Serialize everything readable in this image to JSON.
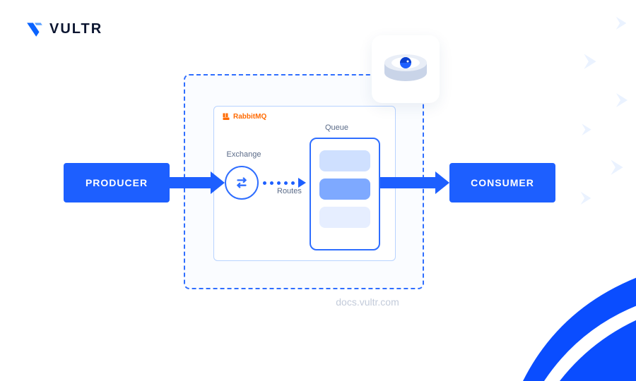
{
  "brand": {
    "name": "VULTR"
  },
  "producer": "PRODUCER",
  "consumer": "CONSUMER",
  "rabbitmq": "RabbitMQ",
  "exchange": "Exchange",
  "routes": "Routes",
  "queue": "Queue",
  "footer": "docs.vultr.com",
  "colors": {
    "primary": "#1d5fff",
    "arrow": "#1d5fff",
    "rabbitOrange": "#ff6a00",
    "muted": "#5b6b88",
    "pale": "#eaf2ff"
  },
  "diagram": {
    "flow": "PRODUCER → Exchange → (Routes) → Queue → CONSUMER",
    "broker": "RabbitMQ"
  }
}
